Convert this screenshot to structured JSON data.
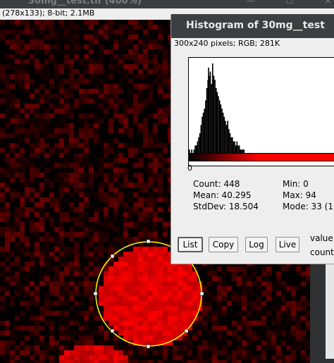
{
  "image_window": {
    "title": "30mg__test.tif (400%)",
    "controls": "— ☐ ✕",
    "info": "(278x133); 8-bit; 2.1MB"
  },
  "histogram_window": {
    "title": "Histogram of 30mg__test",
    "subtitle": "300x240 pixels; RGB; 281K",
    "axis_min_label": "0",
    "stats": {
      "count": "Count: 448",
      "mean": "Mean: 40.295",
      "stddev": "StdDev: 18.504",
      "min": "Min: 0",
      "max": "Max: 94",
      "mode": "Mode: 33 (1"
    },
    "buttons": {
      "list": "List",
      "copy": "Copy",
      "log": "Log",
      "live": "Live"
    },
    "side_labels": {
      "value": "value",
      "count": "count"
    }
  },
  "chart_data": {
    "type": "bar",
    "title": "",
    "xlabel": "",
    "ylabel": "",
    "xlim": [
      0,
      255
    ],
    "x": [
      0,
      4,
      8,
      10,
      12,
      14,
      16,
      18,
      20,
      22,
      24,
      26,
      28,
      30,
      32,
      33,
      34,
      36,
      38,
      40,
      42,
      44,
      46,
      48,
      50,
      52,
      54,
      56,
      58,
      60,
      62,
      64,
      66,
      68,
      70,
      72,
      74,
      76,
      78,
      80,
      82,
      84,
      86,
      88,
      90,
      92,
      94
    ],
    "values": [
      1,
      1,
      1,
      2,
      2,
      3,
      4,
      5,
      7,
      9,
      10,
      11,
      13,
      16,
      18,
      21,
      19,
      20,
      17,
      22,
      19,
      18,
      16,
      15,
      14,
      13,
      12,
      11,
      10,
      9,
      8,
      7,
      8,
      6,
      5,
      4,
      4,
      3,
      3,
      2,
      3,
      2,
      2,
      1,
      1,
      1,
      1
    ],
    "colors": {
      "bars": "#000000",
      "lut": "#ff0000",
      "roi": "#ffff00"
    }
  }
}
